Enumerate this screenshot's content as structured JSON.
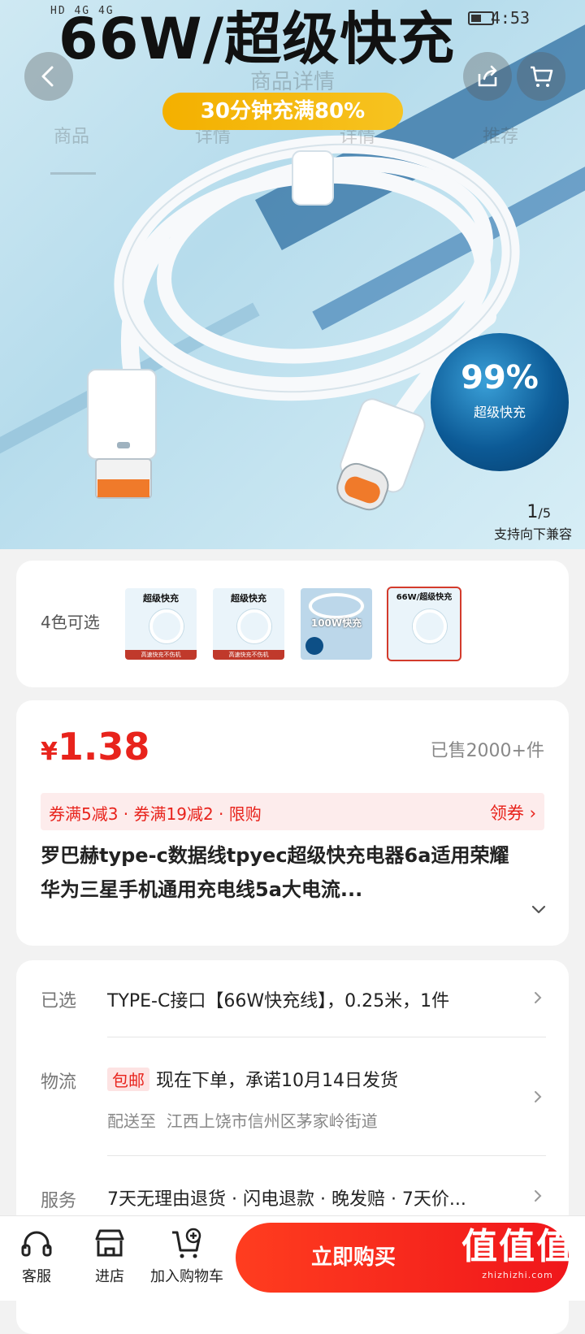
{
  "status_bar": {
    "left": "HD 4G 4G",
    "time": "4:53"
  },
  "hero": {
    "headline": "66W/超级快充",
    "badge": "30分钟充满80%",
    "ghost_title": "商品详情",
    "ghost_tabs": [
      "商品",
      "详情",
      "详情",
      "推荐"
    ],
    "drop_percent": "99%",
    "drop_label": "超级快充",
    "pager_current": "1",
    "pager_total": "/5",
    "compat_text": "支持向下兼容"
  },
  "colors": {
    "label": "4色可选",
    "thumbnails": [
      {
        "title": "超级快充",
        "strip": "高速快充不伤机"
      },
      {
        "title": "超级快充",
        "strip": "高速快充不伤机"
      },
      {
        "title": "100W快充",
        "strip": ""
      },
      {
        "title": "66W/超级快充",
        "strip": ""
      }
    ]
  },
  "product": {
    "currency": "¥",
    "price": "1.38",
    "sold": "已售2000+件",
    "promo": "券满5减3 · 券满19减2 · 限购",
    "coupon": "领券 ›",
    "title": "罗巴赫type-c数据线tpyec超级快充电器6a适用荣耀华为三星手机通用充电线5a大电流..."
  },
  "spec": {
    "selected_label": "已选",
    "selected_value": "TYPE-C接口【66W快充线】，0.25米，1件",
    "logistics_label": "物流",
    "free_shipping": "包邮",
    "logistics_value": "现在下单，承诺10月14日发货",
    "ship_to_label": "配送至",
    "ship_to": "江西上饶市信州区茅家岭街道",
    "service_label": "服务",
    "service_value": "7天无理由退货 · 闪电退款 · 晚发赔 · 7天价..."
  },
  "bottom_bar": {
    "service": "客服",
    "store": "进店",
    "add_cart": "加入购物车",
    "buy_now": "立即购买"
  },
  "watermark": {
    "big": "值值值",
    "small": "zhizhizhi.com"
  }
}
